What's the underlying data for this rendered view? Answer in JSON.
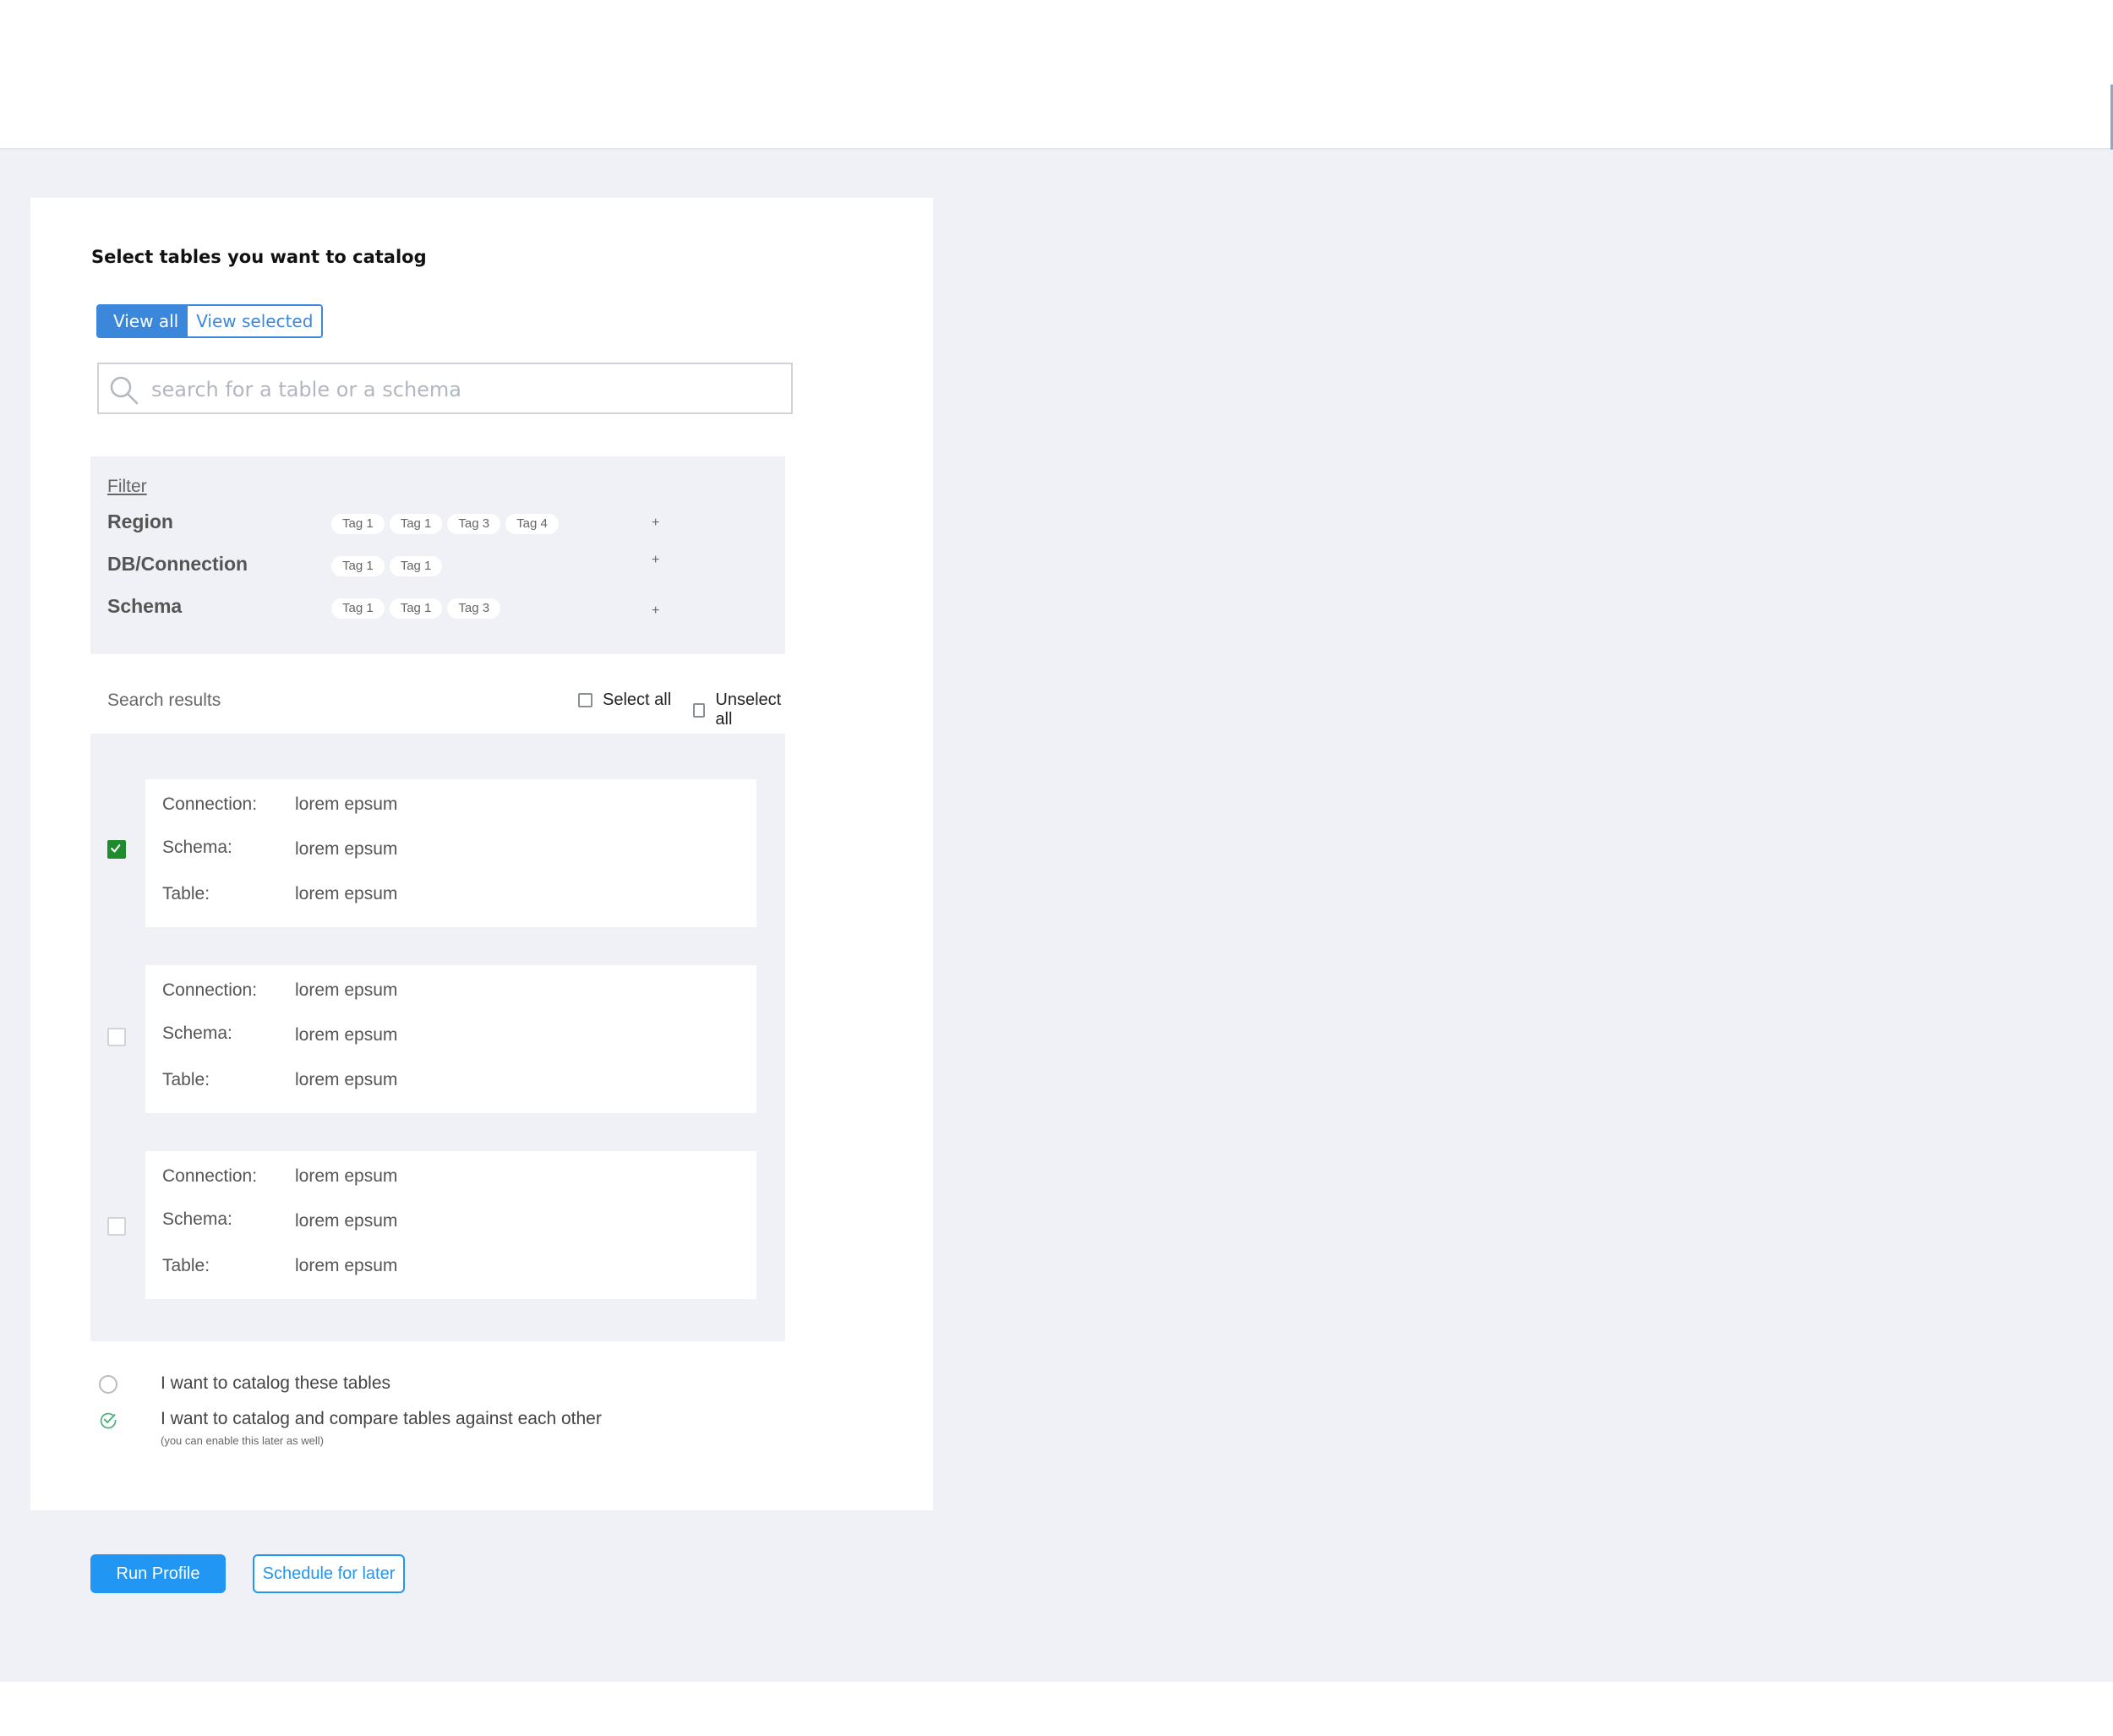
{
  "page": {
    "heading": "Select tables you want to catalog"
  },
  "view_toggle": {
    "options": [
      "View all",
      "View selected"
    ],
    "selected": "View all"
  },
  "search": {
    "placeholder": "search for a table or a schema",
    "value": ""
  },
  "filter": {
    "link_label": "Filter",
    "rows": [
      {
        "label": "Region",
        "tags": [
          "Tag 1",
          "Tag 1",
          "Tag 3",
          "Tag 4"
        ],
        "add_label": "+"
      },
      {
        "label": "DB/Connection",
        "tags": [
          "Tag 1",
          "Tag 1"
        ],
        "add_label": "+"
      },
      {
        "label": "Schema",
        "tags": [
          "Tag 1",
          "Tag 1",
          "Tag 3"
        ],
        "add_label": "+"
      }
    ]
  },
  "results": {
    "title": "Search results",
    "select_all_label": "Select all",
    "unselect_all_label": "Unselect all",
    "items": [
      {
        "checked": true,
        "fields": [
          {
            "key": "Connection:",
            "value": "lorem epsum"
          },
          {
            "key": "Schema:",
            "value": "lorem epsum"
          },
          {
            "key": "Table:",
            "value": "lorem epsum"
          }
        ]
      },
      {
        "checked": false,
        "fields": [
          {
            "key": "Connection:",
            "value": "lorem epsum"
          },
          {
            "key": "Schema:",
            "value": "lorem epsum"
          },
          {
            "key": "Table:",
            "value": "lorem epsum"
          }
        ]
      },
      {
        "checked": false,
        "fields": [
          {
            "key": "Connection:",
            "value": "lorem epsum"
          },
          {
            "key": "Schema:",
            "value": "lorem epsum"
          },
          {
            "key": "Table:",
            "value": "lorem epsum"
          }
        ]
      }
    ]
  },
  "catalog_options": {
    "options": [
      {
        "label": "I want to catalog these tables",
        "selected": false,
        "note": ""
      },
      {
        "label": "I want to catalog and compare tables against each other",
        "selected": true,
        "note": "(you can enable this later as well)"
      }
    ]
  },
  "actions": {
    "primary_label": "Run Profile",
    "secondary_label": "Schedule for later"
  },
  "colors": {
    "accent_blue": "#3a87dc",
    "button_blue": "#2196f3",
    "check_green": "#1f8a2e",
    "radio_green": "#4caf7d",
    "panel_bg": "#eff1f6"
  },
  "icons": {
    "search": "search-icon",
    "checkmark": "checkmark-icon",
    "radio_check": "check-circle-icon"
  }
}
